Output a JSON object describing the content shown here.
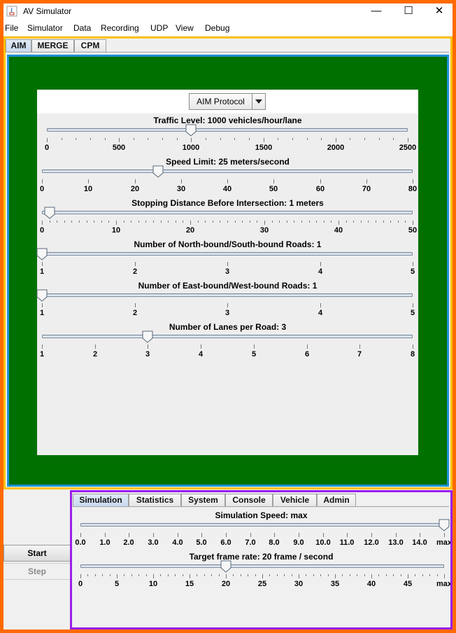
{
  "window": {
    "title": "AV Simulator",
    "controls": {
      "minimize": "—",
      "maximize": "☐",
      "close": "✕"
    }
  },
  "menu": [
    "File",
    "Simulator",
    "Data",
    "Recording",
    "UDP",
    "View",
    "Debug"
  ],
  "top_tabs": [
    {
      "label": "AIM",
      "active": true
    },
    {
      "label": "MERGE",
      "active": false
    },
    {
      "label": "CPM",
      "active": false
    }
  ],
  "protocol_select": {
    "value": "AIM Protocol"
  },
  "aim_sliders": [
    {
      "label": "Traffic Level: 1000 vehicles/hour/lane",
      "min": 0,
      "max": 2500,
      "value": 1000,
      "major_labels": [
        "0",
        "500",
        "1000",
        "1500",
        "2000",
        "2500"
      ],
      "minor_ticks": 25
    },
    {
      "label": "Speed Limit: 25 meters/second",
      "min": 0,
      "max": 80,
      "value": 25,
      "major_labels": [
        "0",
        "10",
        "20",
        "30",
        "40",
        "50",
        "60",
        "70",
        "80"
      ],
      "minor_ticks": 8
    },
    {
      "label": "Stopping Distance Before Intersection: 1 meters",
      "min": 0,
      "max": 50,
      "value": 1,
      "major_labels": [
        "0",
        "10",
        "20",
        "30",
        "40",
        "50"
      ],
      "minor_ticks": 50
    },
    {
      "label": "Number of North-bound/South-bound Roads: 1",
      "min": 1,
      "max": 5,
      "value": 1,
      "major_labels": [
        "1",
        "2",
        "3",
        "4",
        "5"
      ],
      "minor_ticks": 0
    },
    {
      "label": "Number of East-bound/West-bound Roads: 1",
      "min": 1,
      "max": 5,
      "value": 1,
      "major_labels": [
        "1",
        "2",
        "3",
        "4",
        "5"
      ],
      "minor_ticks": 0
    },
    {
      "label": "Number of Lanes per Road: 3",
      "min": 1,
      "max": 8,
      "value": 3,
      "major_labels": [
        "1",
        "2",
        "3",
        "4",
        "5",
        "6",
        "7",
        "8"
      ],
      "minor_ticks": 0
    }
  ],
  "controls": {
    "start_label": "Start",
    "step_label": "Step"
  },
  "bottom_tabs": [
    {
      "label": "Simulation",
      "active": true
    },
    {
      "label": "Statistics",
      "active": false
    },
    {
      "label": "System",
      "active": false
    },
    {
      "label": "Console",
      "active": false
    },
    {
      "label": "Vehicle",
      "active": false
    },
    {
      "label": "Admin",
      "active": false
    }
  ],
  "simulation_sliders": [
    {
      "label": "Simulation Speed: max",
      "value_fraction": 1.0,
      "major_labels": [
        "0.0",
        "1.0",
        "2.0",
        "3.0",
        "4.0",
        "5.0",
        "6.0",
        "7.0",
        "8.0",
        "9.0",
        "10.0",
        "11.0",
        "12.0",
        "13.0",
        "14.0",
        "max"
      ],
      "minor_ticks": 0
    },
    {
      "label": "Target frame rate: 20 frame / second",
      "value_fraction": 0.4,
      "major_labels": [
        "0",
        "5",
        "10",
        "15",
        "20",
        "25",
        "30",
        "35",
        "40",
        "45",
        "max"
      ],
      "minor_ticks": 50
    }
  ]
}
